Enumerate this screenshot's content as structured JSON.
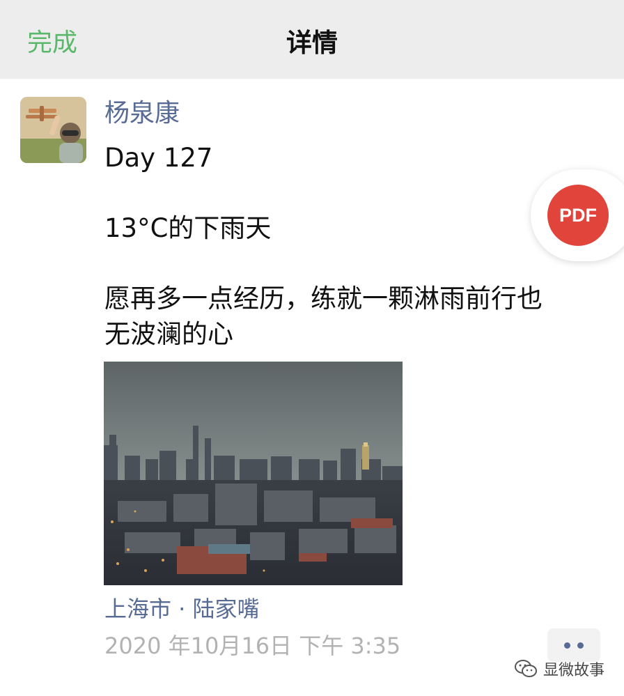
{
  "nav": {
    "done_label": "完成",
    "title": "详情"
  },
  "post": {
    "author": "杨泉康",
    "lines": [
      "Day 127",
      "13°C的下雨天",
      "愿再多一点经历，练就一颗淋雨前行也",
      "无波澜的心"
    ],
    "location": "上海市 · 陆家嘴",
    "timestamp": "2020 年10月16日 下午 3:35"
  },
  "pdf_button": {
    "label": "PDF"
  },
  "watermark": {
    "text": "显微故事"
  },
  "icons": {
    "avatar": "avatar-image",
    "more": "more-dots-icon",
    "watermark": "wechat-icon"
  },
  "colors": {
    "nav_bg": "#ededed",
    "done": "#5ab86a",
    "link": "#576b95",
    "timestamp": "#b2b2b2",
    "pdf": "#e0443a"
  }
}
